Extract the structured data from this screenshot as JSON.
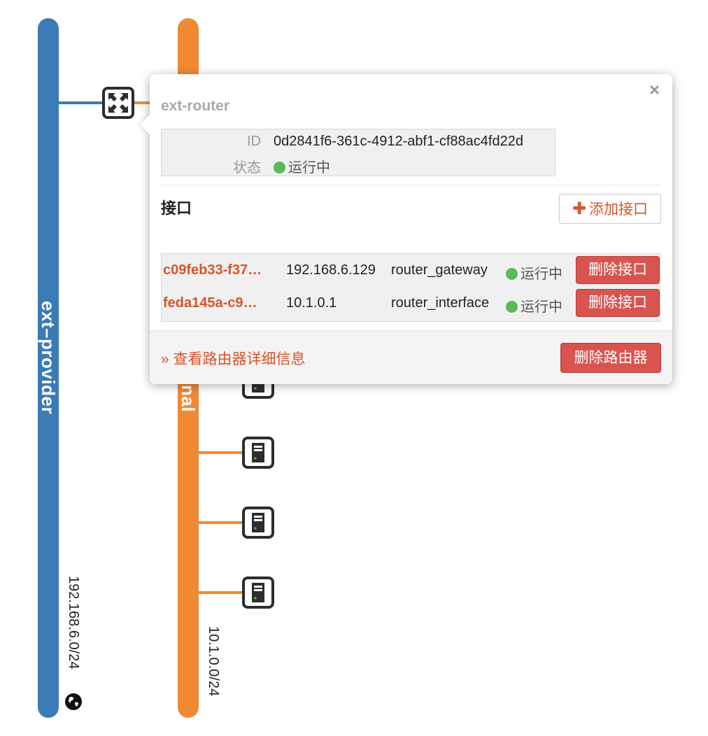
{
  "colors": {
    "external_network": "#3a7bb6",
    "internal_network": "#f08934",
    "accent": "#d9542b",
    "danger": "#d9534f",
    "status_active": "#5cb85c"
  },
  "networks": {
    "external": {
      "name": "ext–provider",
      "cidr": "192.168.6.0/24",
      "icon": "globe-icon"
    },
    "internal": {
      "name_visible_fragment": "nal",
      "cidr": "10.1.0.0/24"
    }
  },
  "router": {
    "icon": "router-icon"
  },
  "instances": {
    "icon": "server-icon"
  },
  "popover": {
    "title": "ext-router",
    "close_glyph": "×",
    "info": {
      "id_label": "ID",
      "id_value": "0d2841f6-361c-4912-abf1-cf88ac4fd22d",
      "status_label": "状态",
      "status_value": "运行中"
    },
    "interfaces_title": "接口",
    "add_interface_label": "添加接口",
    "add_interface_glyph": "✚",
    "interfaces": [
      {
        "id": "c09feb33-f37…",
        "ip": "192.168.6.129",
        "owner": "router_gateway",
        "status": "运行中",
        "delete_label": "删除接口"
      },
      {
        "id": "feda145a-c9…",
        "ip": "10.1.0.1",
        "owner": "router_interface",
        "status": "运行中",
        "delete_label": "删除接口"
      }
    ],
    "detail_link": "» 查看路由器详细信息",
    "delete_router_label": "删除路由器"
  }
}
